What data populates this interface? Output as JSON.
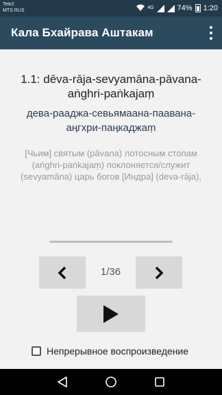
{
  "status_bar": {
    "carrier_1": "Tele2",
    "carrier_2": "MTS RUS",
    "network_badge": "4G",
    "battery_percent": "74%",
    "time": "1:20",
    "icon_color": "#ffffff"
  },
  "app_bar": {
    "title": "Кала Бхайрава Аштакам",
    "menu_icon": "more-vert-icon",
    "background": "#2b4a5e"
  },
  "verse": {
    "title": "1.1: dēva-rāja-sevyamāna-pāvana-aṅghri-paṅkajaṃ",
    "cyrillic": "дева-рааджа-севьямаана-паавана-аӊгхри-паӊкаджаṃ",
    "translation": "[Чьим] святым (pāvana) лотосным стопам (aṅghri-paṅkajaṃ) поклоняется/служит (sevyamāna) царь богов [Индра] (deva-rāja),"
  },
  "player": {
    "progress_fraction": 0,
    "prev_icon": "chevron-left-icon",
    "next_icon": "chevron-right-icon",
    "play_icon": "play-icon",
    "page_indicator": "1/36"
  },
  "autoplay": {
    "label": "Непрерывное воспроизведение",
    "checked": false
  },
  "nav_bar": {
    "back_icon": "back-triangle-icon",
    "home_icon": "home-circle-icon",
    "recent_icon": "recent-square-icon"
  }
}
